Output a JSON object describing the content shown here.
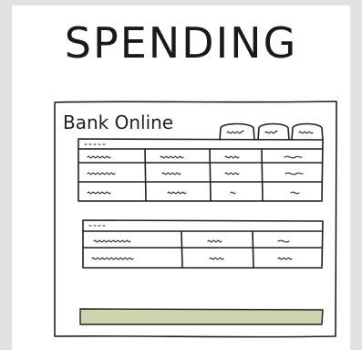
{
  "comic": {
    "title": "SPENDING"
  },
  "window": {
    "app_name": "Bank Online",
    "tabs": [
      {
        "label": "illegible scribble"
      },
      {
        "label": "illegible scribble"
      },
      {
        "label": "illegible scribble"
      }
    ]
  },
  "tables": {
    "top": {
      "rows": 3,
      "columns": 4
    },
    "bottom": {
      "rows": 2,
      "columns": 3
    }
  },
  "colors": {
    "bar_fill": "#ccd4b0",
    "ink": "#1f1f1f"
  }
}
